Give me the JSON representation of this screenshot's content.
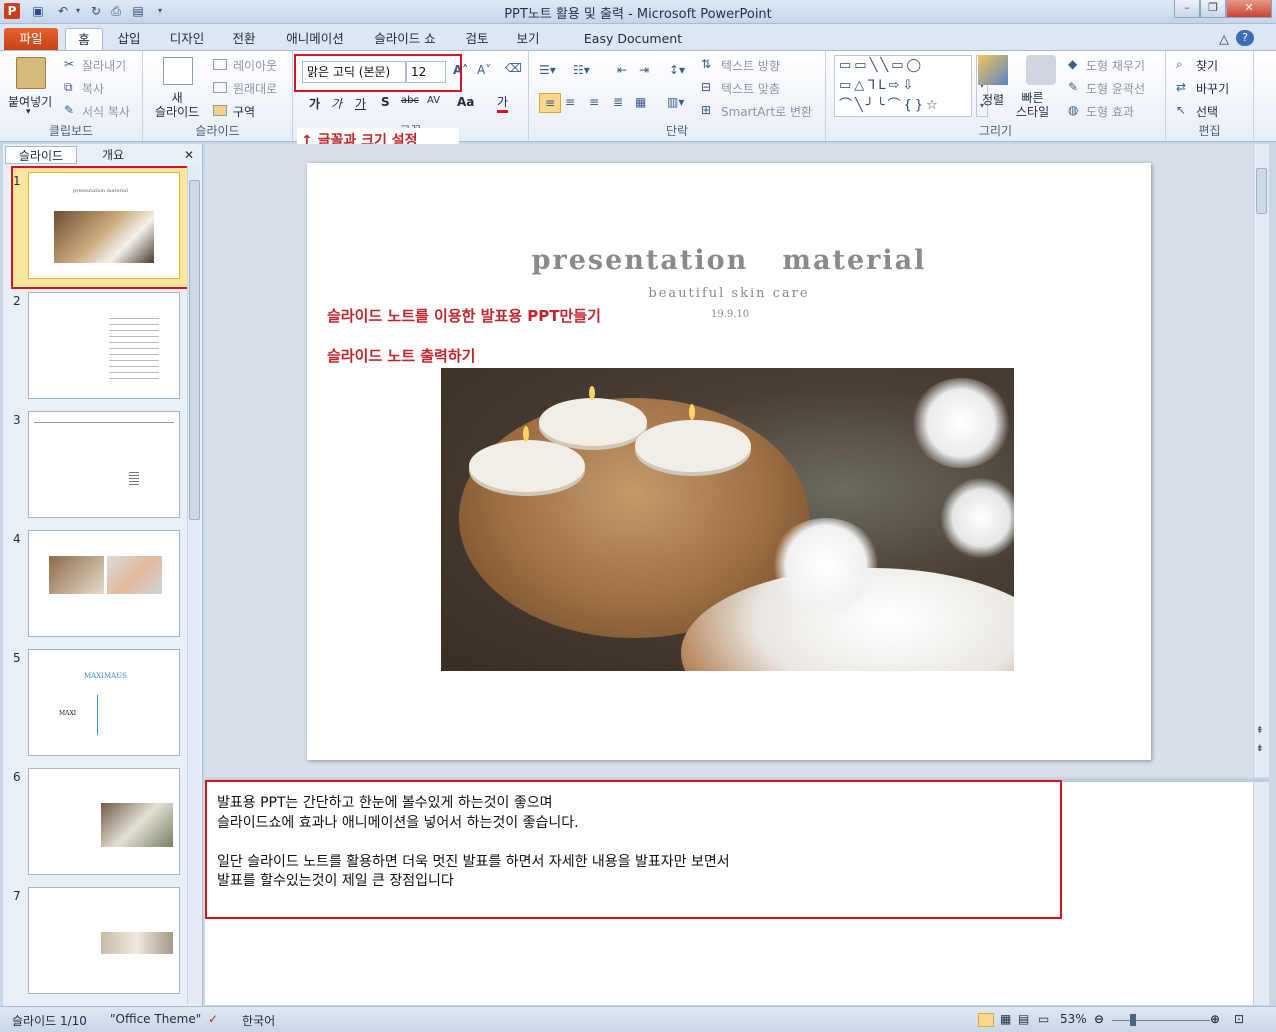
{
  "window": {
    "title": "PPT노트 활용 및 출력 - Microsoft PowerPoint",
    "controls": {
      "minimize": "–",
      "restore": "❐",
      "close": "✕"
    }
  },
  "tabs": [
    "파일",
    "홈",
    "삽입",
    "디자인",
    "전환",
    "애니메이션",
    "슬라이드 쇼",
    "검토",
    "보기",
    "Easy Document Creator"
  ],
  "ribbon": {
    "clipboard": {
      "paste": "붙여넣기",
      "cut": "잘라내기",
      "copy": "복사",
      "format_painter": "서식 복사",
      "label": "클립보드"
    },
    "slides": {
      "new_slide": "새\n슬라이드",
      "layout": "레이아웃",
      "reset": "원래대로",
      "section": "구역",
      "label": "슬라이드"
    },
    "font": {
      "font_name": "맑은 고딕 (본문)",
      "font_size": "12",
      "bold": "가",
      "italic": "가",
      "underline": "가",
      "shadow": "S",
      "strike": "abc",
      "spacing": "AV",
      "case": "Aa",
      "color": "가",
      "label": "글꼴"
    },
    "paragraph": {
      "text_direction": "텍스트 방향",
      "align_text": "텍스트 맞춤",
      "smartart": "SmartArt로 변환",
      "label": "단락"
    },
    "drawing": {
      "arrange": "정렬",
      "quick_styles": "빠른\n스타일",
      "shape_fill": "도형 채우기",
      "shape_outline": "도형 윤곽선",
      "shape_effects": "도형 효과",
      "label": "그리기"
    },
    "editing": {
      "find": "찾기",
      "replace": "바꾸기",
      "select": "선택",
      "label": "편집"
    }
  },
  "annotation": "↑ 글꼴과 크기 설정",
  "panel": {
    "tabs": [
      "슬라이드",
      "개요"
    ],
    "thumbnails": [
      "1",
      "2",
      "3",
      "4",
      "5",
      "6",
      "7"
    ]
  },
  "slide": {
    "title": "presentation   material",
    "subtitle": "beautiful skin care",
    "date": "19.9.10",
    "red_line_1": "슬라이드 노트를 이용한 발표용 PPT만들기",
    "red_line_2": "슬라이드 노트 출력하기"
  },
  "thumb_texts": {
    "t1_title": "presentation material",
    "t5_title": "MAXIMAUS",
    "t5_left": "MAXI"
  },
  "notes": {
    "line1": "발표용 PPT는 간단하고 한눈에 볼수있게 하는것이 좋으며",
    "line2": "슬라이드쇼에 효과나 애니메이션을 넣어서 하는것이 좋습니다.",
    "line3": "",
    "line4": "일단 슬라이드 노트를 활용하면 더욱 멋진 발표를 하면서 자세한 내용을 발표자만 보면서",
    "line5": "발표를 할수있는것이 제일 큰 장점입니다"
  },
  "status": {
    "slide_info": "슬라이드 1/10",
    "theme": "\"Office Theme\"",
    "language": "한국어",
    "zoom": "53%"
  },
  "colors": {
    "accent_red": "#d5141e",
    "slide_red_text": "#c0272d",
    "file_tab": "#d64f22"
  }
}
